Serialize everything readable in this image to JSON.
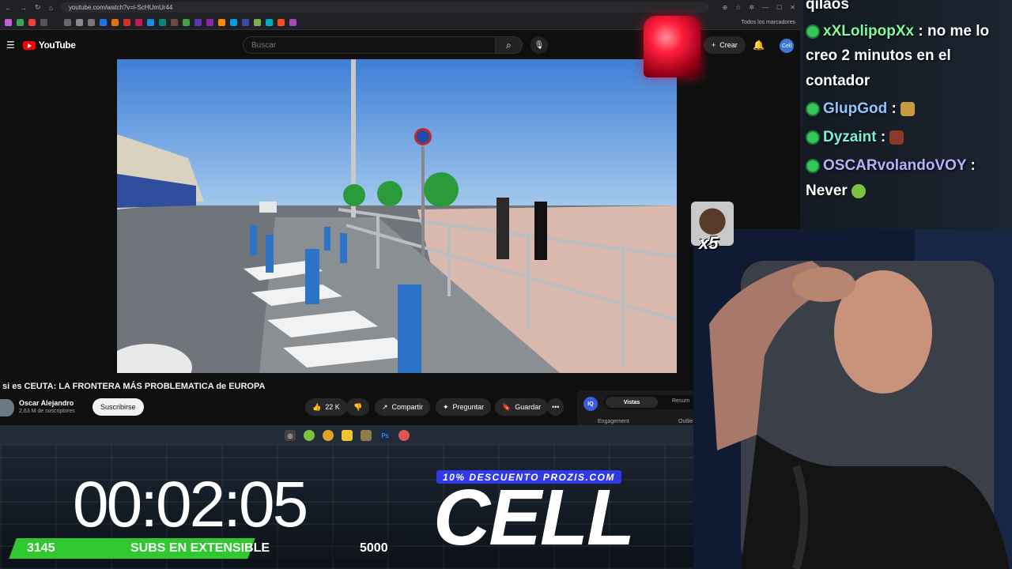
{
  "browser": {
    "url": "youtube.com/watch?v=i-ScHUmUr44",
    "bookmarks_all": "Todos los marcadores"
  },
  "youtube": {
    "logo_text": "YouTube",
    "search_placeholder": "Buscar",
    "create_label": "Crear",
    "avatar_text": "Cell"
  },
  "video": {
    "title": "si es CEUTA: LA FRONTERA MÁS PROBLEMATICA de EUROPA",
    "channel_name": "Oscar Alejandro",
    "channel_subs": "2,63 M de suscriptores",
    "subscribe_label": "Suscribirse",
    "likes": "22 K",
    "share_label": "Compartir",
    "ask_label": "Preguntar",
    "save_label": "Guardar",
    "more_label": "•••"
  },
  "stats_panel": {
    "badge": "IQ",
    "tab_active": "Vistas",
    "tab_other": "Resum",
    "metric_left": "Engagement",
    "metric_right": "Outlie"
  },
  "chat": {
    "messages": [
      {
        "user": "",
        "text": "qilaos"
      },
      {
        "user": "xXLolipopXx",
        "text": ": no me lo"
      },
      {
        "user": "",
        "text": "creo 2 minutos en el"
      },
      {
        "user": "",
        "text": "contador"
      },
      {
        "user": "GlupGod",
        "text": ":"
      },
      {
        "user": "Dyzaint",
        "text": ":"
      },
      {
        "user": "OSCARvolandoVOY",
        "text": ":"
      },
      {
        "user": "",
        "text": "Never"
      }
    ]
  },
  "alert": {
    "multiplier": "x5"
  },
  "overlay": {
    "timer": "00:02:05",
    "promo": "10% DESCUENTO PROZIS.COM",
    "brand": "CELL",
    "subs_current": "3145",
    "subs_label": "SUBS EN EXTENSIBLE",
    "subs_goal": "5000",
    "subs_progress": 0.629
  },
  "colors": {
    "yt_red": "#ff0000",
    "subs_green": "#2fc82f",
    "promo_blue": "#3138e6"
  }
}
